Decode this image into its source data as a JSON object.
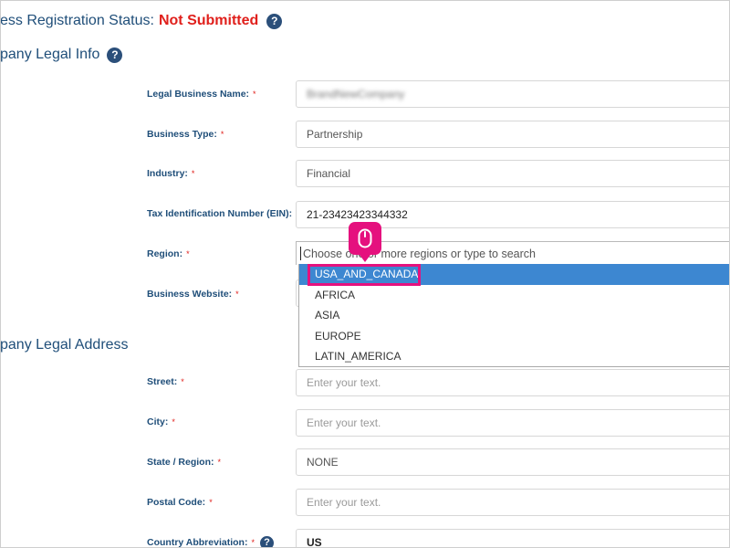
{
  "registration": {
    "label": "ess Registration Status:",
    "value": "Not Submitted",
    "help_text": "?"
  },
  "legal_info": {
    "title": "pany Legal Info",
    "help_text": "?",
    "legal_business_name": {
      "label": "Legal Business Name:",
      "value": "BrandNewCompany"
    },
    "business_type": {
      "label": "Business Type:",
      "value": "Partnership"
    },
    "industry": {
      "label": "Industry:",
      "value": "Financial"
    },
    "tax_id": {
      "label": "Tax Identification Number (EIN):",
      "value": "21-23423423344332"
    },
    "region": {
      "label": "Region:",
      "placeholder": "Choose one or more regions or type to search",
      "options": [
        "USA_AND_CANADA",
        "AFRICA",
        "ASIA",
        "EUROPE",
        "LATIN_AMERICA"
      ],
      "highlighted": "USA_AND_CANADA"
    },
    "business_website": {
      "label": "Business Website:"
    }
  },
  "legal_address": {
    "title": "pany Legal Address",
    "street": {
      "label": "Street:",
      "placeholder": "Enter your text."
    },
    "city": {
      "label": "City:",
      "placeholder": "Enter your text."
    },
    "state": {
      "label": "State / Region:",
      "value": "NONE"
    },
    "postal_code": {
      "label": "Postal Code:",
      "placeholder": "Enter your text."
    },
    "country_abbreviation": {
      "label": "Country Abbreviation:",
      "value": "US",
      "help_text": "?"
    }
  },
  "required_marker": "*",
  "colors": {
    "accent": "#1f4e79",
    "error": "#e0201c",
    "highlight": "#e5117e",
    "selected": "#3d87d1"
  },
  "icons": {
    "cursor": "mouse-icon",
    "help": "help-icon"
  }
}
